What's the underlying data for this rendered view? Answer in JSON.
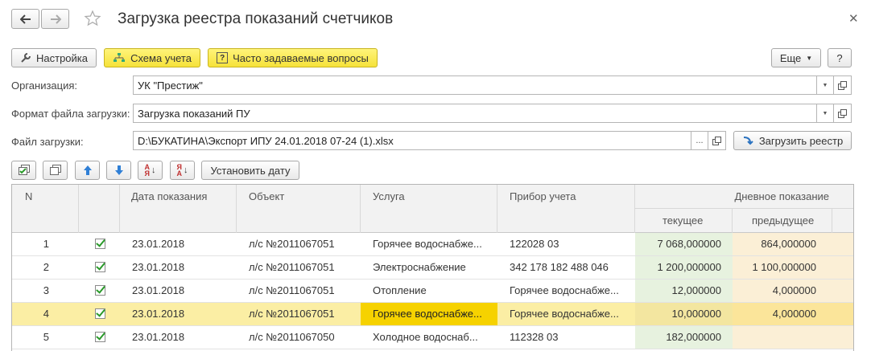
{
  "window": {
    "title": "Загрузка реестра показаний счетчиков",
    "back_icon": "arrow-left-icon",
    "forward_icon": "arrow-right-icon",
    "favorite_icon": "star-icon",
    "close_icon": "close-icon"
  },
  "toolbar": {
    "settings_label": "Настройка",
    "scheme_label": "Схема учета",
    "faq_label": "Часто задаваемые вопросы",
    "more_label": "Еще",
    "help_label": "?"
  },
  "form": {
    "org_label": "Организация:",
    "org_value": "УК \"Престиж\"",
    "format_label": "Формат файла загрузки:",
    "format_value": "Загрузка показаний ПУ",
    "file_label": "Файл загрузки:",
    "file_value": "D:\\БУКАТИНА\\Экспорт ИПУ 24.01.2018 07-24 (1).xlsx",
    "browse_label": "...",
    "load_label": "Загрузить реестр"
  },
  "table_toolbar": {
    "set_date_label": "Установить дату"
  },
  "table": {
    "headers": {
      "n": "N",
      "date": "Дата показания",
      "object": "Объект",
      "service": "Услуга",
      "device": "Прибор учета",
      "day_reading": "Дневное показание",
      "current": "текущее",
      "previous": "предыдущее"
    },
    "rows": [
      {
        "n": "1",
        "date": "23.01.2018",
        "object": "л/с №2011067051",
        "service": "Горячее водоснабже...",
        "device": "122028 03",
        "current": "7 068,000000",
        "previous": "864,000000"
      },
      {
        "n": "2",
        "date": "23.01.2018",
        "object": "л/с №2011067051",
        "service": "Электроснабжение",
        "device": "342 178 182 488 046",
        "current": "1 200,000000",
        "previous": "1 100,000000"
      },
      {
        "n": "3",
        "date": "23.01.2018",
        "object": "л/с №2011067051",
        "service": "Отопление",
        "device": "Горячее водоснабже...",
        "current": "12,000000",
        "previous": "4,000000"
      },
      {
        "n": "4",
        "date": "23.01.2018",
        "object": "л/с №2011067051",
        "service": "Горячее водоснабже...",
        "device": "Горячее водоснабже...",
        "current": "10,000000",
        "previous": "4,000000"
      },
      {
        "n": "5",
        "date": "23.01.2018",
        "object": "л/с №2011067050",
        "service": "Холодное водоснаб...",
        "device": "112328 03",
        "current": "182,000000",
        "previous": ""
      }
    ]
  },
  "colors": {
    "selected_row": "#fbeea4",
    "selected_cell": "#f6d200",
    "current_col": "#e7f2df",
    "previous_col": "#fbefd6",
    "checkmark": "#2a9a2a"
  }
}
